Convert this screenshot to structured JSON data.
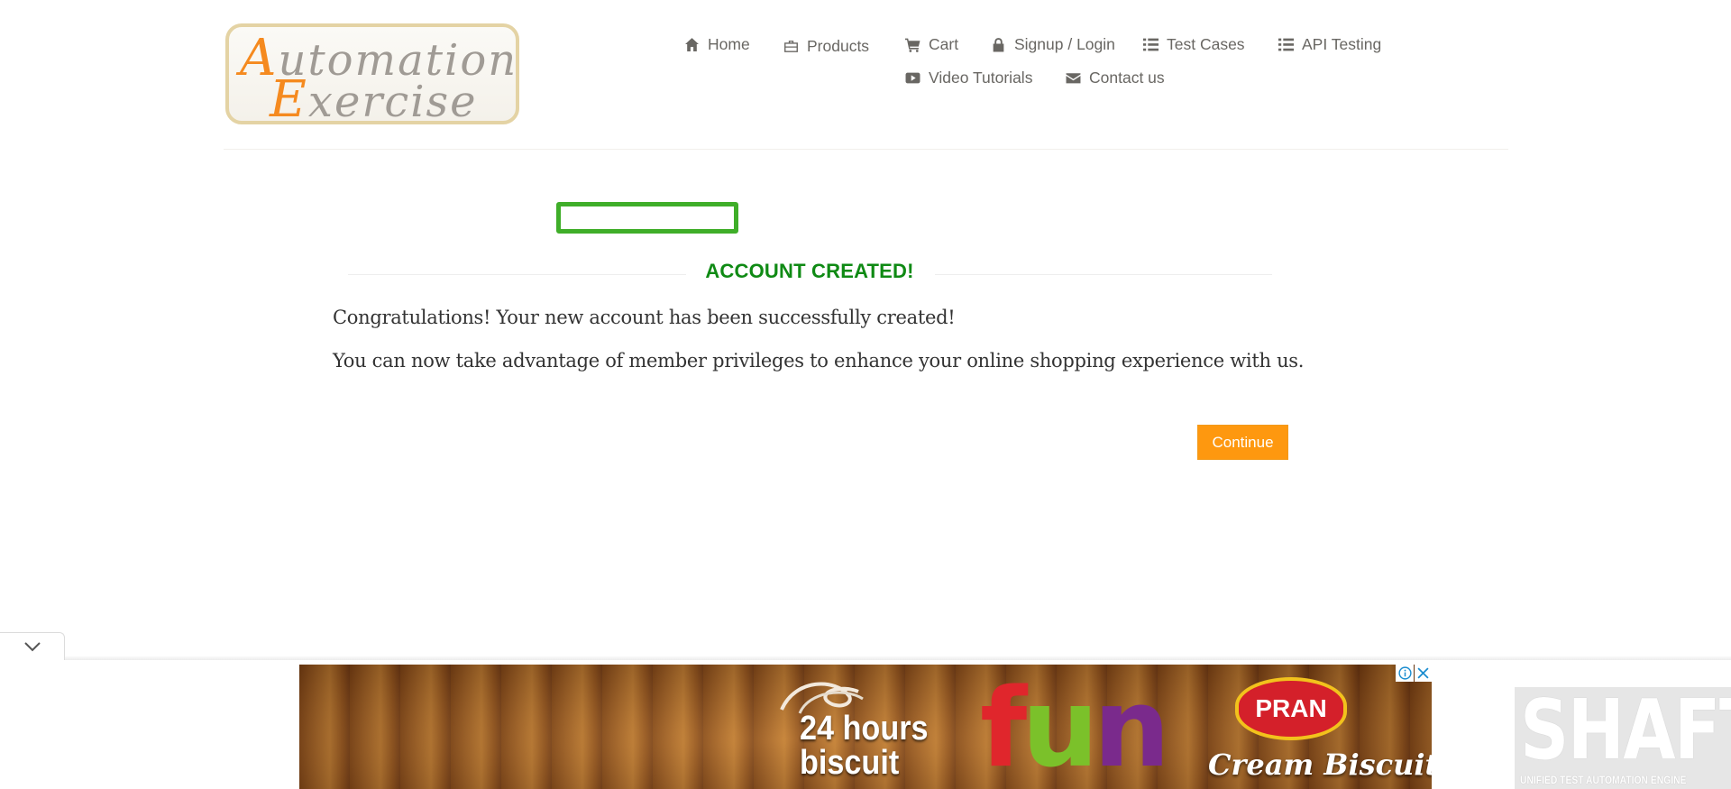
{
  "logo": {
    "line1_cap": "A",
    "line1_rest": "utomation",
    "line2_cap": "E",
    "line2_rest": "xercise"
  },
  "nav": {
    "home": "Home",
    "products": "Products",
    "cart": "Cart",
    "signup_login": "Signup / Login",
    "test_cases": "Test Cases",
    "api_testing": "API Testing",
    "video_tutorials": "Video Tutorials",
    "contact_us": "Contact us"
  },
  "main": {
    "title": "ACCOUNT CREATED!",
    "message1": "Congratulations! Your new account has been successfully created!",
    "message2": "You can now take advantage of member privileges to enhance your online shopping experience with us.",
    "continue_label": "Continue"
  },
  "ad": {
    "line1": "24 hours",
    "line2": "biscuit",
    "fun_f": "f",
    "fun_u": "u",
    "fun_n": "n",
    "brand": "PRAN",
    "product": "Cream Biscuit"
  },
  "watermark": {
    "title": "SHAFT",
    "subtitle": "UNIFIED TEST AUTOMATION ENGINE"
  },
  "colors": {
    "accent": "#fe980f",
    "success": "#0f8a14",
    "highlight": "#3fae29"
  }
}
